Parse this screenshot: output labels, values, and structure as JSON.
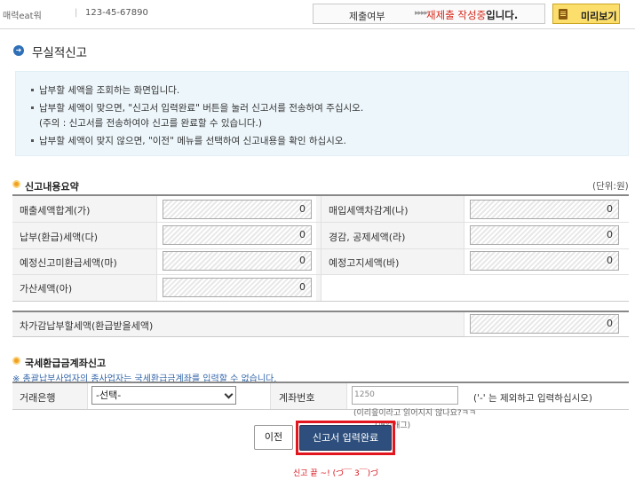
{
  "header": {
    "app_name": "매력eat워",
    "separator": "|",
    "business_no": "123-45-67890",
    "status_label": "제출여부",
    "status_arrows": "▸▸▸▸",
    "status_value_red": "재제출 작성중",
    "status_value_suffix": "입니다.",
    "preview_button": "미리보기"
  },
  "page": {
    "title": "무실적신고"
  },
  "info": {
    "lines": [
      "납부할 세액을 조회하는 화면입니다.",
      "납부할 세액이 맞으면, \"신고서 입력완료\" 버튼을 눌러 신고서를 전송하여 주십시오.",
      "(주의 : 신고서를 전송하여야 신고를 완료할 수 있습니다.)",
      "납부할 세액이 맞지 않으면, \"이전\" 메뉴를 선택하여 신고내용을 확인 하십시오."
    ]
  },
  "summary": {
    "title": "신고내용요약",
    "unit": "(단위:원)",
    "rows": [
      {
        "left_label": "매출세액합계(가)",
        "left_value": "0",
        "right_label": "매입세액차감계(나)",
        "right_value": "0"
      },
      {
        "left_label": "납부(환급)세액(다)",
        "left_value": "0",
        "right_label": "경감, 공제세액(라)",
        "right_value": "0"
      },
      {
        "left_label": "예정신고미환급세액(마)",
        "left_value": "0",
        "right_label": "예정고지세액(바)",
        "right_value": "0"
      },
      {
        "left_label": "가산세액(아)",
        "left_value": "0"
      }
    ],
    "total_label": "차가감납부할세액(환급받을세액)",
    "total_value": "0"
  },
  "refund": {
    "title": "국세환급금계좌신고",
    "note": "※ 총괄납부사업자의 종사업자는 국세환급금계좌를 입력할 수 없습니다.",
    "bank_label": "거래은행",
    "bank_selected": "-선택-",
    "account_label": "계좌번호",
    "account_value": "1250",
    "account_hint": "('-' 는 제외하고 입력하십시오)",
    "joke_line1": "(이리읖이라고 읽어지지 않나요?ㅋㅋ",
    "joke_line2": "(깨알개그)"
  },
  "buttons": {
    "prev": "이전",
    "submit": "신고서 입력완료"
  },
  "footer_note": "신고 끝 ~! (づ￣ 3￣)づ"
}
